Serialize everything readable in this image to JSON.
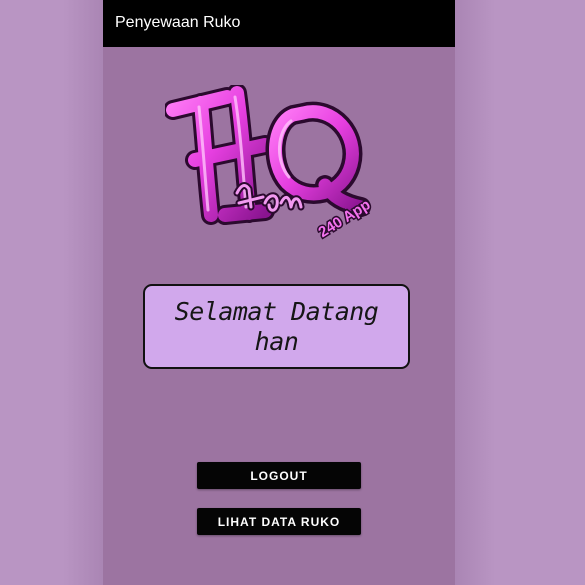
{
  "app_bar": {
    "title": "Penyewaan Ruko"
  },
  "logo": {
    "icon": "hq-han-logo",
    "text_main": "HQ",
    "text_sub": "Han",
    "text_badge": "240 App"
  },
  "welcome": {
    "line1": "Selamat Datang",
    "line2": "han"
  },
  "buttons": {
    "logout_label": "LOGOUT",
    "lihat_label": "LIHAT DATA RUKO"
  },
  "colors": {
    "page_background": "#b995c3",
    "screen_background": "#9c74a1",
    "app_bar": "#000000",
    "welcome_box": "#d1a8ec",
    "logo_magenta": "#e63fe0",
    "button": "#050505"
  }
}
